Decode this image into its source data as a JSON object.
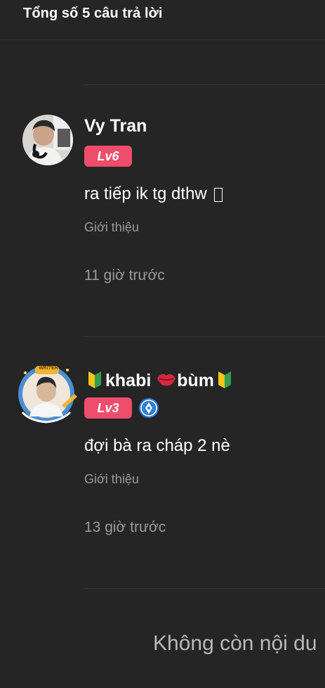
{
  "header": {
    "title": "Tổng số 5 câu trả lời"
  },
  "comments": [
    {
      "username": "Vy Tran",
      "level": "Lv6",
      "text": "ra tiếp ik tg dthw",
      "intro": "Giới thiệu",
      "time": "11 giờ trước",
      "level_color": "#ee4d6b"
    },
    {
      "username_prefix_icon": "beginner-badge-icon",
      "username_parts": [
        "khabi",
        "bùm"
      ],
      "username_mid_icon": "kiss-lips-icon",
      "username_suffix_icon": "beginner-badge-icon",
      "level": "Lv3",
      "extra_badge_icon": "pen-nib-icon",
      "avatar_frame_label": "WRITER",
      "text": "đợi bà ra cháp 2 nè",
      "intro": "Giới thiệu",
      "time": "13 giờ trước",
      "level_color": "#ee4d6b"
    }
  ],
  "footer": {
    "end_text": "Không còn nội du"
  },
  "colors": {
    "background": "#252525",
    "muted_text": "#9a9a9a",
    "divider": "#333333"
  }
}
